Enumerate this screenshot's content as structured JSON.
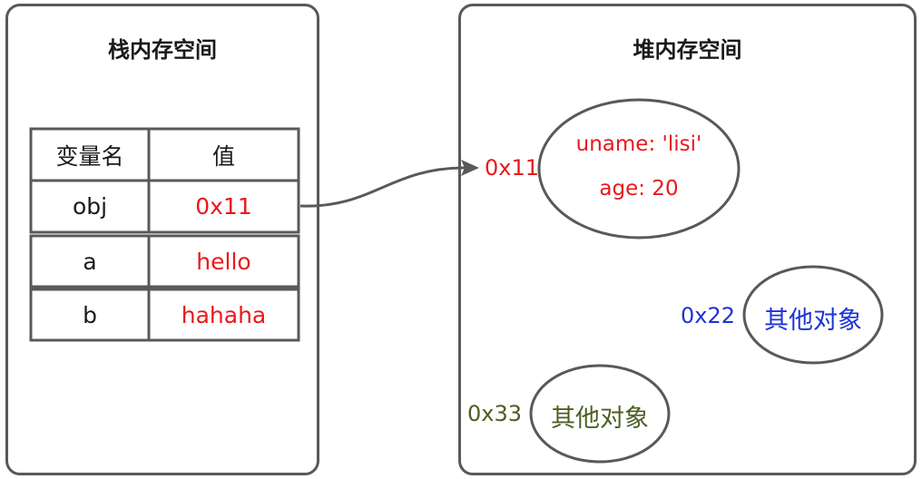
{
  "stack": {
    "title": "栈内存空间",
    "headers": {
      "name": "变量名",
      "value": "值"
    },
    "rows": [
      {
        "name": "obj",
        "value": "0x11"
      },
      {
        "name": "a",
        "value": "hello"
      },
      {
        "name": "b",
        "value": "hahaha"
      }
    ]
  },
  "heap": {
    "title": "堆内存空间",
    "objects": [
      {
        "address": "0x11",
        "lines": [
          "uname: 'lisi'",
          "age: 20"
        ],
        "color": "#e8191d"
      },
      {
        "address": "0x22",
        "label": "其他对象",
        "color": "#1d32d6"
      },
      {
        "address": "0x33",
        "label": "其他对象",
        "color": "#4d5e25"
      }
    ]
  },
  "colors": {
    "border": "#595959",
    "red": "#e8191d",
    "blue": "#1d32d6",
    "olive": "#4d5e25"
  }
}
